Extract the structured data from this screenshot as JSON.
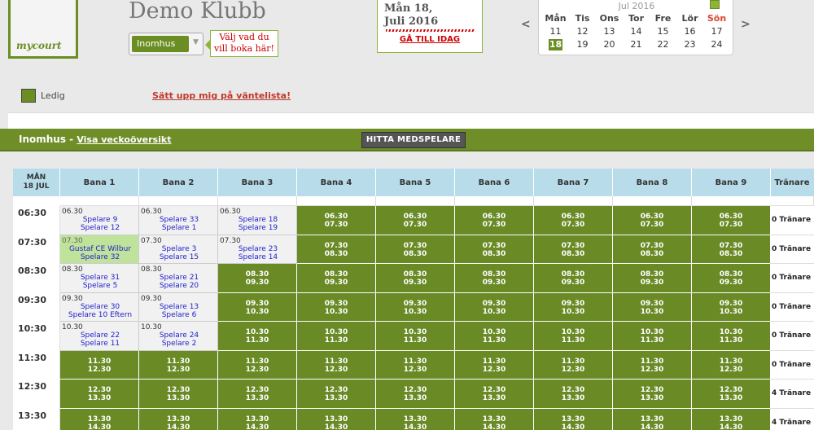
{
  "header": {
    "logo_text": "mycourt",
    "club_name": "Demo Klubb",
    "venue_select": "Inomhus",
    "tip_line1": "Välj vad du",
    "tip_line2": "vill boka här!",
    "date_line1": "Mån 18,",
    "date_line2": "Juli 2016",
    "goto_today": "GÅ TILL IDAG",
    "prev_glyph": "<",
    "next_glyph": ">"
  },
  "calendar": {
    "month": "Jul 2016",
    "weekdays": [
      "Mån",
      "Tis",
      "Ons",
      "Tor",
      "Fre",
      "Lör",
      "Sön"
    ],
    "week1": [
      "11",
      "12",
      "13",
      "14",
      "15",
      "16",
      "17"
    ],
    "week2": [
      "18",
      "19",
      "20",
      "21",
      "22",
      "23",
      "24"
    ],
    "selected": "18"
  },
  "legend": {
    "label": "Ledig",
    "color": "#6b8e23"
  },
  "waitlist_link": "Sätt upp mig på väntelista!",
  "section": {
    "title": "Inomhus",
    "sep": " - ",
    "week_link": "Visa veckoöversikt",
    "find_button": "HITTA MEDSPELARE"
  },
  "grid": {
    "day_header_1": "MÅN",
    "day_header_2": "18 JUL",
    "courts": [
      "Bana 1",
      "Bana 2",
      "Bana 3",
      "Bana 4",
      "Bana 5",
      "Bana 6",
      "Bana 7",
      "Bana 8",
      "Bana 9"
    ],
    "trainer_header": "Tränare",
    "times": [
      "06:30",
      "07:30",
      "08:30",
      "09:30",
      "10:30",
      "11:30",
      "12:30",
      "13:30"
    ],
    "slots": [
      {
        "start": "06.30",
        "end": "07.30",
        "trainer": "0 Tränare"
      },
      {
        "start": "07.30",
        "end": "08.30",
        "trainer": "0 Tränare"
      },
      {
        "start": "08.30",
        "end": "09.30",
        "trainer": "0 Tränare"
      },
      {
        "start": "09.30",
        "end": "10.30",
        "trainer": "0 Tränare"
      },
      {
        "start": "10.30",
        "end": "11.30",
        "trainer": "0 Tränare"
      },
      {
        "start": "11.30",
        "end": "12.30",
        "trainer": "0 Tränare"
      },
      {
        "start": "12.30",
        "end": "13.30",
        "trainer": "4 Tränare"
      },
      {
        "start": "13.30",
        "end": "14.30",
        "trainer": "4 Tränare"
      }
    ],
    "bookings": [
      {
        "row": 0,
        "court": 0,
        "time": "06.30",
        "p1": "Spelare 9",
        "p2": "Spelare 12"
      },
      {
        "row": 0,
        "court": 1,
        "time": "06.30",
        "p1": "Spelare 33",
        "p2": "Spelare 1"
      },
      {
        "row": 0,
        "court": 2,
        "time": "06.30",
        "p1": "Spelare 18",
        "p2": "Spelare 19"
      },
      {
        "row": 1,
        "court": 0,
        "time": "07.30",
        "p1": "Gustaf CE Wilbur",
        "p2": "Spelare 32",
        "own": true
      },
      {
        "row": 1,
        "court": 1,
        "time": "07.30",
        "p1": "Spelare 3",
        "p2": "Spelare 15"
      },
      {
        "row": 1,
        "court": 2,
        "time": "07.30",
        "p1": "Spelare 23",
        "p2": "Spelare 14"
      },
      {
        "row": 2,
        "court": 0,
        "time": "08.30",
        "p1": "Spelare 31",
        "p2": "Spelare 5"
      },
      {
        "row": 2,
        "court": 1,
        "time": "08.30",
        "p1": "Spelare 21",
        "p2": "Spelare 20"
      },
      {
        "row": 3,
        "court": 0,
        "time": "09.30",
        "p1": "Spelare 30",
        "p2": "Spelare 10 Eftern"
      },
      {
        "row": 3,
        "court": 1,
        "time": "09.30",
        "p1": "Spelare 13",
        "p2": "Spelare 6"
      },
      {
        "row": 4,
        "court": 0,
        "time": "10.30",
        "p1": "Spelare 22",
        "p2": "Spelare 11"
      },
      {
        "row": 4,
        "court": 1,
        "time": "10.30",
        "p1": "Spelare 24",
        "p2": "Spelare 2"
      }
    ]
  }
}
